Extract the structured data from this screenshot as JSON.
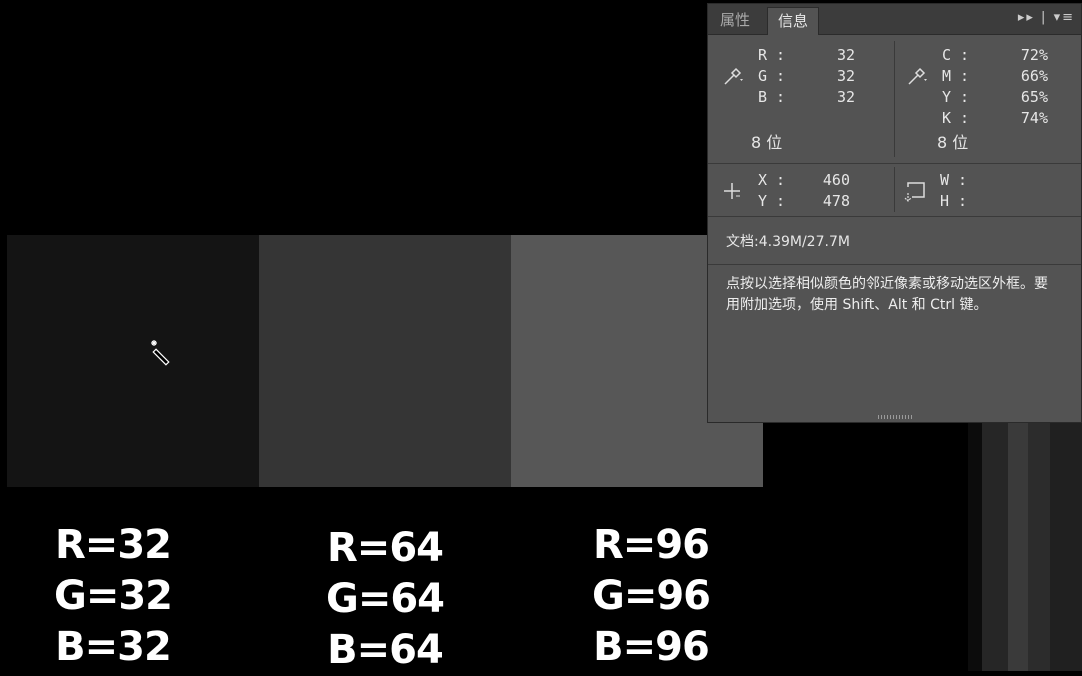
{
  "swatches": [
    {
      "color": "#141414",
      "label_lines": [
        "R=32",
        "G=32",
        "B=32"
      ]
    },
    {
      "color": "#353535",
      "label_lines": [
        "R=64",
        "G=64",
        "B=64"
      ]
    },
    {
      "color": "#575757",
      "label_lines": [
        "R=96",
        "G=96",
        "B=96"
      ]
    }
  ],
  "cursor": {
    "icon": "magic-wand-icon"
  },
  "panel": {
    "tabs": [
      {
        "label": "属性",
        "active": false
      },
      {
        "label": "信息",
        "active": true
      }
    ],
    "tab_controls": "▸▸ | ▾≡",
    "rgb": {
      "icon": "eyedropper-icon",
      "rows": [
        {
          "key": "R :",
          "value": "32"
        },
        {
          "key": "G :",
          "value": "32"
        },
        {
          "key": "B :",
          "value": "32"
        }
      ],
      "bit_depth": "8 位"
    },
    "cmyk": {
      "icon": "eyedropper-icon",
      "rows": [
        {
          "key": "C :",
          "value": "72%"
        },
        {
          "key": "M :",
          "value": "66%"
        },
        {
          "key": "Y :",
          "value": "65%"
        },
        {
          "key": "K :",
          "value": "74%"
        }
      ],
      "bit_depth": "8 位"
    },
    "position": {
      "icon": "crosshair-icon",
      "rows": [
        {
          "key": "X :",
          "value": "460"
        },
        {
          "key": "Y :",
          "value": "478"
        }
      ]
    },
    "size": {
      "icon": "selection-size-icon",
      "rows": [
        {
          "key": "W :",
          "value": ""
        },
        {
          "key": "H :",
          "value": ""
        }
      ]
    },
    "doc_info": "文档:4.39M/27.7M",
    "hint": "点按以选择相似颜色的邻近像素或移动选区外框。要用附加选项，使用 Shift、Alt 和 Ctrl 键。"
  },
  "colors": {
    "background": "#000000",
    "panel_bg": "#535353",
    "tab_bar_bg": "#3c3c3c"
  }
}
